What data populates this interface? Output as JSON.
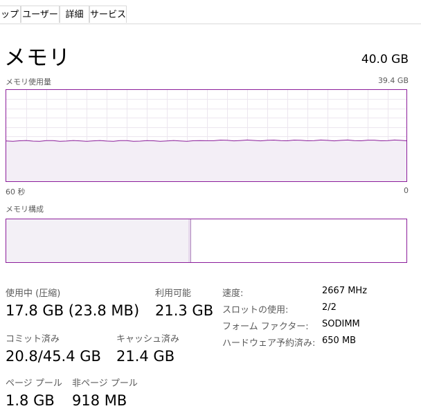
{
  "tabs": [
    {
      "label": "ップ"
    },
    {
      "label": "ユーザー"
    },
    {
      "label": "詳細"
    },
    {
      "label": "サービス"
    }
  ],
  "header": {
    "title": "メモリ",
    "total": "40.0 GB"
  },
  "usage_graph": {
    "label": "メモリ使用量",
    "max_label": "39.4 GB",
    "time_left": "60 秒",
    "time_right": "0",
    "used_fraction": 0.453,
    "color": "#8b1c9a"
  },
  "composition": {
    "label": "メモリ構成",
    "in_use_fraction": 0.455,
    "modified_fraction": 0.006
  },
  "stats": {
    "in_use": {
      "label": "使用中 (圧縮)",
      "value": "17.8 GB (23.8 MB)"
    },
    "available": {
      "label": "利用可能",
      "value": "21.3 GB"
    },
    "committed": {
      "label": "コミット済み",
      "value": "20.8/45.4 GB"
    },
    "cached": {
      "label": "キャッシュ済み",
      "value": "21.4 GB"
    },
    "paged_pool": {
      "label": "ページ プール",
      "value": "1.8 GB"
    },
    "non_paged_pool": {
      "label": "非ページ プール",
      "value": "918 MB"
    }
  },
  "properties": [
    {
      "key": "速度:",
      "value": "2667 MHz"
    },
    {
      "key": "スロットの使用:",
      "value": "2/2"
    },
    {
      "key": "フォーム ファクター:",
      "value": "SODIMM"
    },
    {
      "key": "ハードウェア予約済み:",
      "value": "650 MB"
    }
  ]
}
